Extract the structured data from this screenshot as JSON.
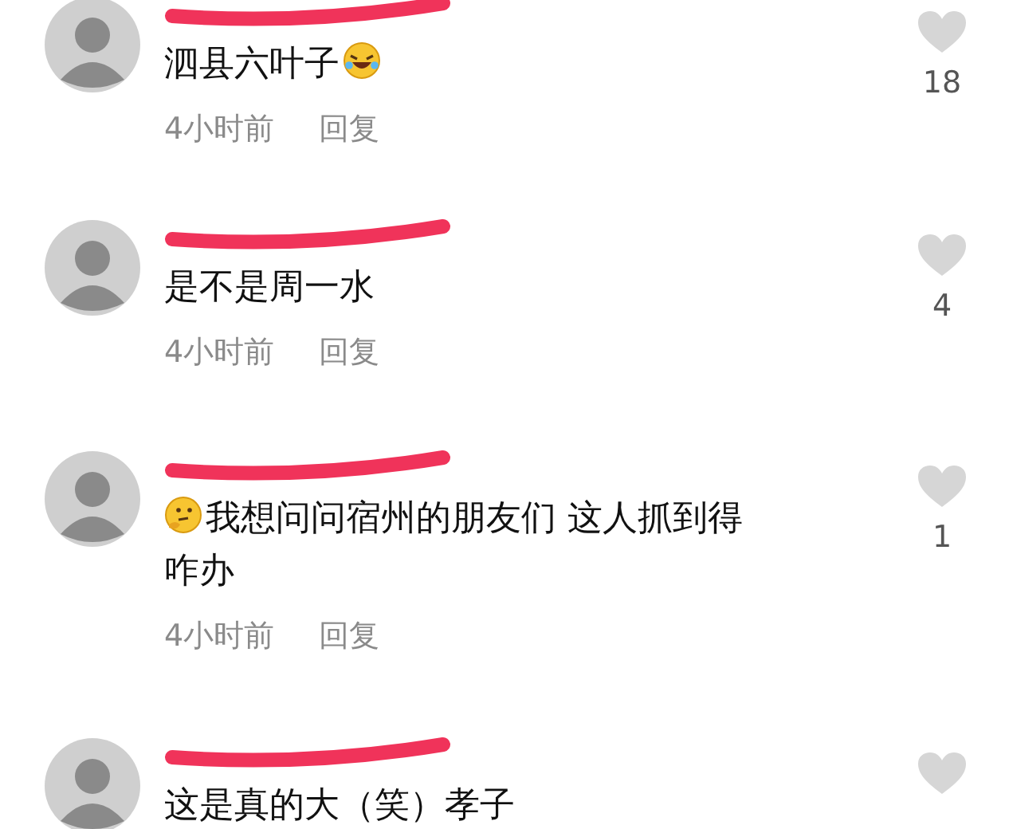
{
  "comments": [
    {
      "lines": [
        [
          {
            "kind": "text",
            "text": "泗县六叶子"
          },
          {
            "kind": "laughing"
          }
        ]
      ],
      "time": "4小时前",
      "reply": "回复",
      "likes": "18"
    },
    {
      "lines": [
        [
          {
            "kind": "text",
            "text": "是不是周一水"
          }
        ]
      ],
      "time": "4小时前",
      "reply": "回复",
      "likes": "4"
    },
    {
      "lines": [
        [
          {
            "kind": "thinking"
          },
          {
            "kind": "text",
            "text": "我想问问宿州的朋友们 这人抓到得"
          }
        ],
        [
          {
            "kind": "text",
            "text": "咋办"
          }
        ]
      ],
      "time": "4小时前",
      "reply": "回复",
      "likes": "1"
    },
    {
      "lines": [
        [
          {
            "kind": "text",
            "text": "这是真的大（笑）孝子"
          }
        ]
      ]
    }
  ]
}
